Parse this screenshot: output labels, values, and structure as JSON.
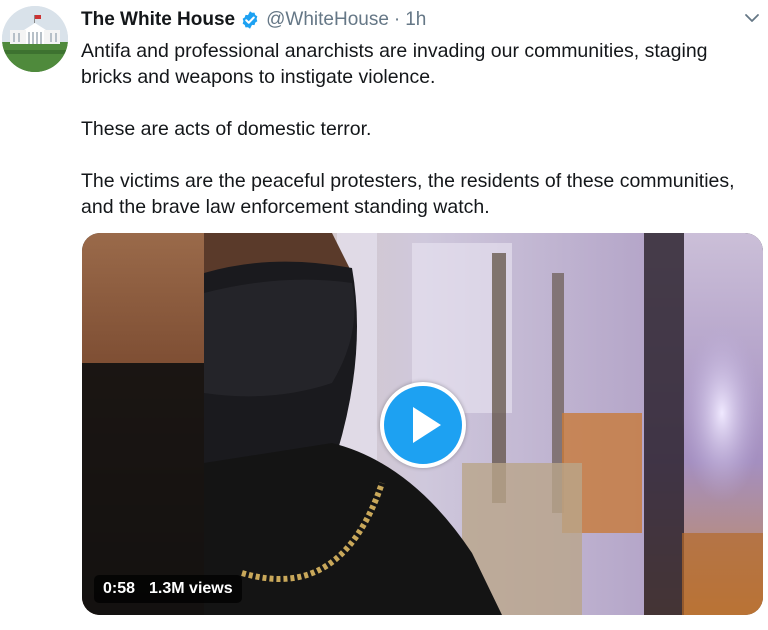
{
  "tweet": {
    "display_name": "The White House",
    "handle": "@WhiteHouse",
    "separator": "·",
    "time": "1h",
    "paragraphs": [
      "Antifa and professional anarchists are invading our communities, staging bricks and weapons to instigate violence.",
      "These are acts of domestic terror.",
      "The victims are the peaceful protesters, the residents of these communities, and the brave law enforcement standing watch."
    ],
    "video": {
      "duration": "0:58",
      "views": "1.3M views"
    }
  },
  "icons": {
    "verified": "verified-badge-icon",
    "menu": "chevron-down-icon",
    "play": "play-icon"
  },
  "colors": {
    "brand_blue": "#1da1f2",
    "text": "#14171a",
    "muted": "#657786"
  }
}
